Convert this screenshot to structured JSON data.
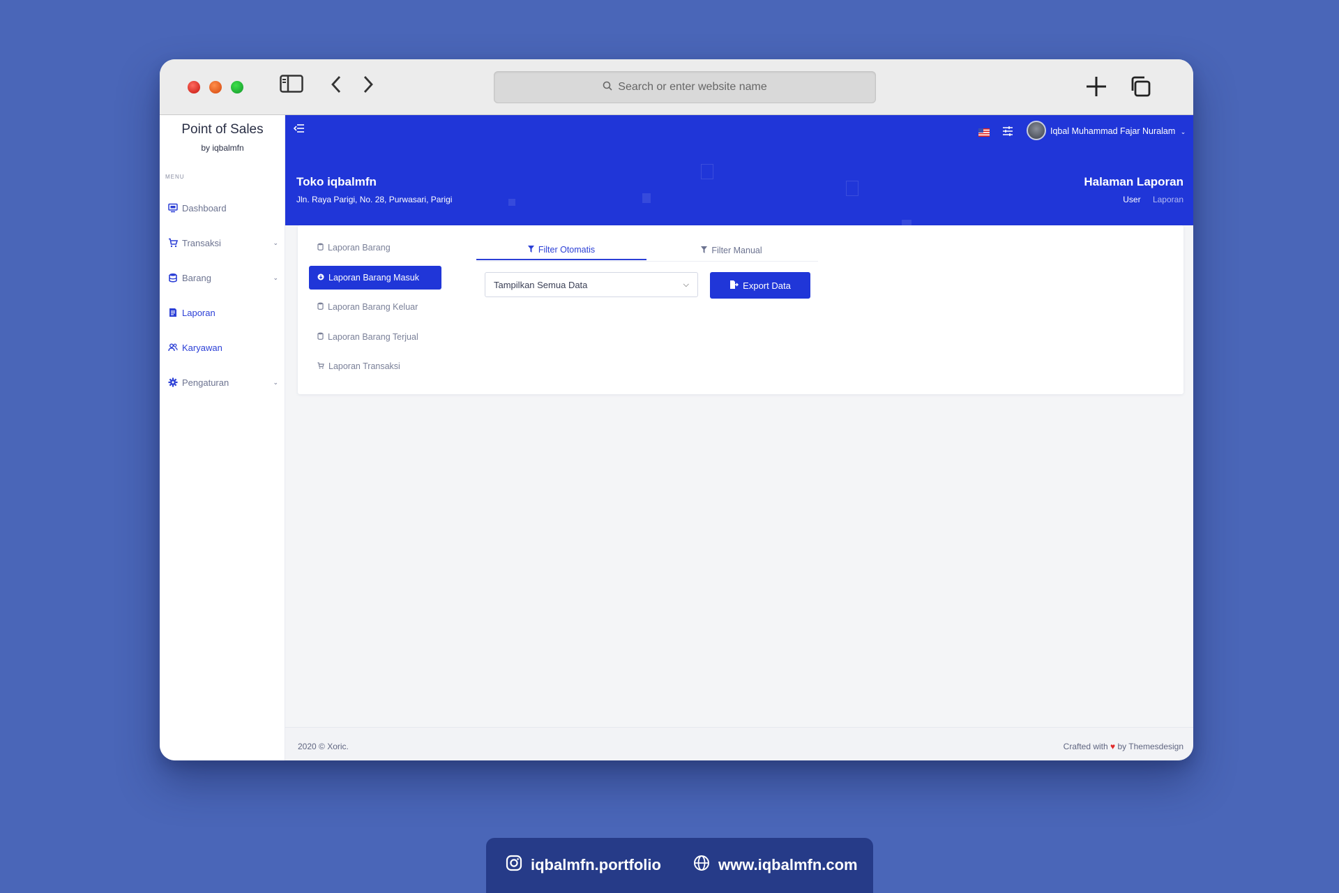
{
  "browser": {
    "address_placeholder": "Search or enter website name"
  },
  "sidebar": {
    "brand_title": "Point of Sales",
    "brand_sub": "by iqbalmfn",
    "menu_label": "MENU",
    "items": [
      {
        "label": "Dashboard",
        "icon": "monitor-icon",
        "has_chevron": false,
        "active": false
      },
      {
        "label": "Transaksi",
        "icon": "cart-icon",
        "has_chevron": true,
        "active": false
      },
      {
        "label": "Barang",
        "icon": "database-icon",
        "has_chevron": true,
        "active": false
      },
      {
        "label": "Laporan",
        "icon": "report-icon",
        "has_chevron": false,
        "active": true
      },
      {
        "label": "Karyawan",
        "icon": "users-icon",
        "has_chevron": false,
        "active": true
      },
      {
        "label": "Pengaturan",
        "icon": "gear-icon",
        "has_chevron": true,
        "active": false
      }
    ]
  },
  "header": {
    "user_name": "Iqbal Muhammad Fajar Nuralam",
    "store_name": "Toko iqbalmfn",
    "store_address": "Jln. Raya Parigi, No. 28, Purwasari, Parigi",
    "page_title": "Halaman Laporan",
    "breadcrumb": [
      "User",
      "Laporan"
    ]
  },
  "report_tabs": [
    {
      "label": "Laporan Barang",
      "active": false
    },
    {
      "label": "Laporan Barang Masuk",
      "active": true
    },
    {
      "label": "Laporan Barang Keluar",
      "active": false
    },
    {
      "label": "Laporan Barang Terjual",
      "active": false
    },
    {
      "label": "Laporan Transaksi",
      "active": false
    }
  ],
  "filter_tabs": [
    {
      "label": "Filter Otomatis",
      "active": true
    },
    {
      "label": "Filter Manual",
      "active": false
    }
  ],
  "filter": {
    "select_value": "Tampilkan Semua Data",
    "export_label": "Export Data"
  },
  "footer": {
    "left": "2020 © Xoric.",
    "right_prefix": "Crafted with",
    "right_suffix": "by Themesdesign"
  },
  "social": {
    "instagram": "iqbalmfn.portfolio",
    "website": "www.iqbalmfn.com"
  },
  "colors": {
    "primary": "#2036d8",
    "background": "#4a66b8",
    "social_bar": "#263b88"
  }
}
